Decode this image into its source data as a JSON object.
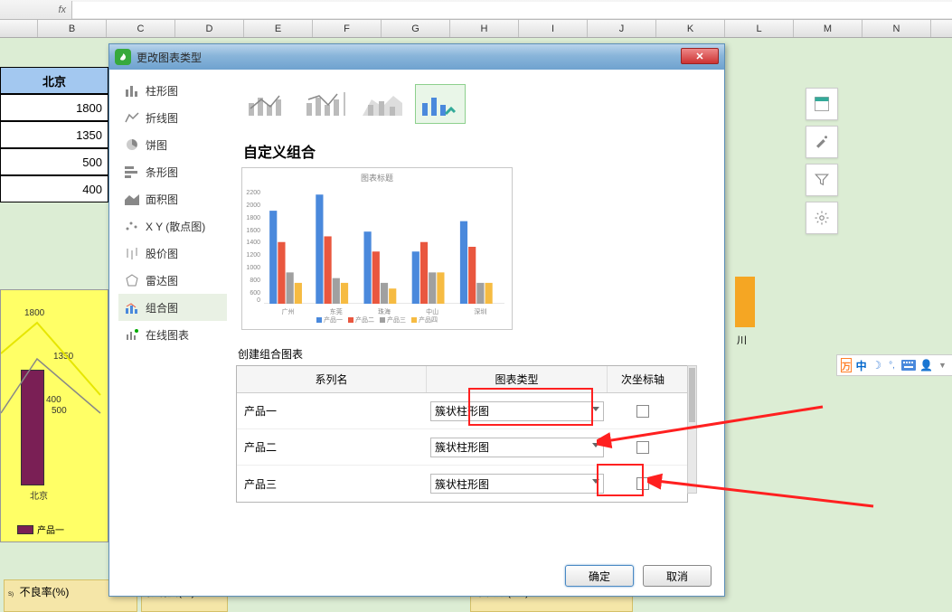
{
  "formula_bar": {
    "fx_label": "fx"
  },
  "columns": [
    "",
    "B",
    "C",
    "D",
    "E",
    "F",
    "G",
    "H",
    "I",
    "J",
    "K",
    "L",
    "M",
    "N"
  ],
  "mgmt_cells": {
    "hdr": "北京",
    "r1": "1800",
    "r2": "1350",
    "r3": "500",
    "r4": "400"
  },
  "bg_chart": {
    "val1": "1800",
    "val2": "1350",
    "val3": "400",
    "val3b": "500",
    "xlabel": "北京",
    "legend": "产品一"
  },
  "bg_chart2_label": "川",
  "dialog": {
    "title": "更改图表类型",
    "nav": [
      "柱形图",
      "折线图",
      "饼图",
      "条形图",
      "面积图",
      "X Y (散点图)",
      "股价图",
      "雷达图",
      "组合图",
      "在线图表"
    ],
    "section_title": "自定义组合",
    "pv_title": "图表标题",
    "pv_legend": [
      "产品一",
      "产品二",
      "产品三",
      "产品四"
    ],
    "create_label": "创建组合图表",
    "tbl_head": {
      "c1": "系列名",
      "c2": "图表类型",
      "c3": "次坐标轴"
    },
    "rows": [
      {
        "name": "产品一",
        "type": "簇状柱形图"
      },
      {
        "name": "产品二",
        "type": "簇状柱形图"
      },
      {
        "name": "产品三",
        "type": "簇状柱形图"
      }
    ],
    "ok": "确定",
    "cancel": "取消"
  },
  "sticky": {
    "s1": "不良率(%)",
    "s2": "影响度(%)",
    "s3": "不良数(PS)"
  },
  "float": {
    "cn": "中"
  },
  "chart_data": {
    "type": "bar",
    "title": "图表标题",
    "categories": [
      "广州",
      "东莞",
      "珠海",
      "中山",
      "深圳"
    ],
    "series": [
      {
        "name": "产品一",
        "values": [
          1800,
          2100,
          1400,
          1000,
          1600
        ],
        "color": "#4a89dc"
      },
      {
        "name": "产品二",
        "values": [
          1200,
          1300,
          1000,
          1200,
          1100
        ],
        "color": "#e9573f"
      },
      {
        "name": "产品三",
        "values": [
          600,
          500,
          400,
          600,
          400
        ],
        "color": "#a0a0a0"
      },
      {
        "name": "产品四",
        "values": [
          400,
          400,
          300,
          600,
          400
        ],
        "color": "#f6bb42"
      }
    ],
    "ylim": [
      0,
      2200
    ],
    "ylabel": "",
    "xlabel": ""
  }
}
